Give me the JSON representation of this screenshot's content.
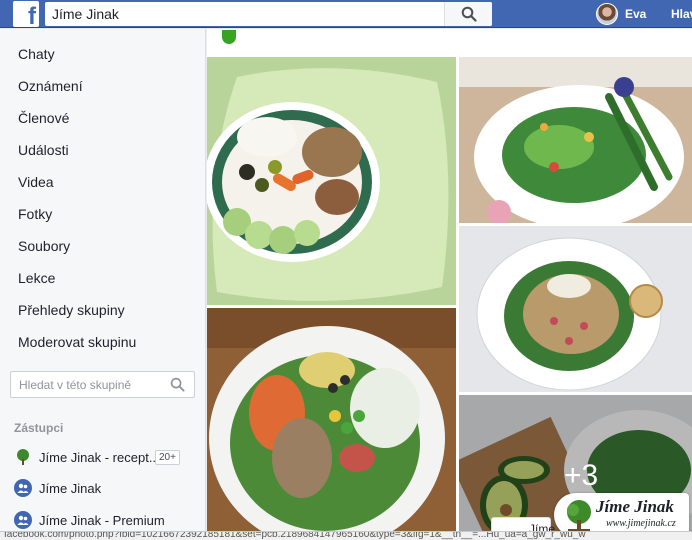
{
  "topbar": {
    "logo_letter": "f",
    "search_value": "Jíme Jinak",
    "user_name": "Eva",
    "home_label": "Hlav"
  },
  "sidebar": {
    "items": [
      {
        "label": "Chaty"
      },
      {
        "label": "Oznámení"
      },
      {
        "label": "Členové"
      },
      {
        "label": "Události"
      },
      {
        "label": "Videa"
      },
      {
        "label": "Fotky"
      },
      {
        "label": "Soubory"
      },
      {
        "label": "Lekce"
      },
      {
        "label": "Přehledy skupiny"
      },
      {
        "label": "Moderovat skupinu"
      }
    ],
    "group_search_placeholder": "Hledat v této skupině",
    "representatives_title": "Zástupci",
    "representatives": [
      {
        "label": "Jíme Jinak - recept...",
        "badge": "20+",
        "icon": "tree-icon"
      },
      {
        "label": "Jíme Jinak",
        "icon": "group-icon"
      },
      {
        "label": "Jíme Jinak - Premium",
        "icon": "group-icon"
      }
    ]
  },
  "main": {
    "photos_more_count": "+3",
    "brand": {
      "name": "Jíme Jinak",
      "url": "www.jimejinak.cz"
    },
    "post_chip_label": "Jíme"
  },
  "statusbar": {
    "url_text": "facebook.com/photo.php?fbid=10216672392185181&set=pcb.2189684147965160&type=3&ifg=1&__tn__=...Hu_ua=a_gw_r_wu_w"
  },
  "colors": {
    "fb_blue": "#4267b2",
    "sidebar_bg": "#f6f7f9",
    "text": "#1d2129",
    "muted": "#90949c"
  }
}
